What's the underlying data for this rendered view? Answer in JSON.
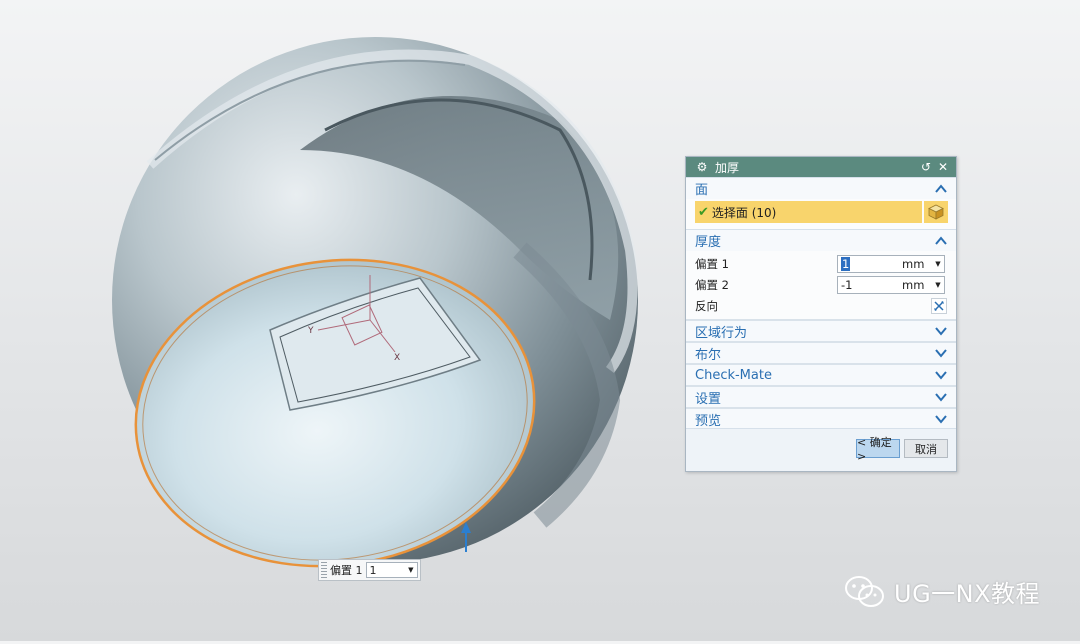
{
  "dialog": {
    "title": "加厚",
    "sections": {
      "face": {
        "label": "面",
        "select_label": "选择面 (10)"
      },
      "thickness": {
        "label": "厚度",
        "offset1": {
          "label": "偏置 1",
          "value": "1",
          "unit": "mm"
        },
        "offset2": {
          "label": "偏置 2",
          "value": "-1",
          "unit": "mm"
        },
        "reverse_label": "反向"
      },
      "collapsed": [
        "区域行为",
        "布尔",
        "Check-Mate",
        "设置",
        "预览"
      ]
    },
    "ok_label": "< 确定 >",
    "cancel_label": "取消"
  },
  "onscreen_input": {
    "label": "偏置 1",
    "value": "1"
  },
  "viewport": {
    "axis_y": "Y",
    "axis_x": "X"
  },
  "watermark": {
    "text": "UG一NX教程"
  },
  "colors": {
    "title_bar": "#5b8a7f",
    "selection_highlight": "#f8d46c",
    "section_text": "#2a6fb2",
    "edge_highlight": "#e8923a"
  }
}
